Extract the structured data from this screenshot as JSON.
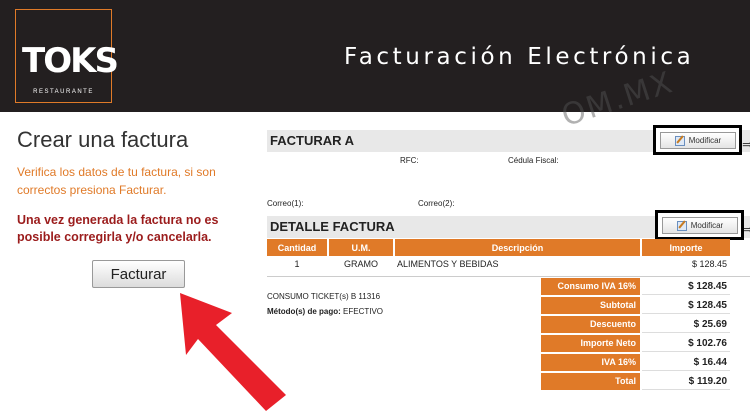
{
  "header": {
    "logo_text": "TOKS",
    "logo_subtitle": "RESTAURANTE",
    "title": "Facturación Electrónica",
    "watermark": "OM.MX"
  },
  "left": {
    "title": "Crear una factura",
    "note": "Verifica los datos de tu factura, si son correctos presiona Facturar.",
    "warning": "Una vez generada la factura no es posible corregirla y/o cancelarla.",
    "button_label": "Facturar"
  },
  "facturar_a": {
    "section_title": "FACTURAR A",
    "modify_label": "Modificar",
    "rfc_label": "RFC:",
    "cedula_label": "Cédula Fiscal:",
    "correo1_label": "Correo(1):",
    "correo2_label": "Correo(2):"
  },
  "detalle": {
    "section_title": "DETALLE FACTURA",
    "modify_label": "Modificar",
    "columns": [
      "Cantidad",
      "U.M.",
      "Descripción",
      "Importe"
    ],
    "rows": [
      [
        "1",
        "GRAMO",
        "ALIMENTOS Y BEBIDAS",
        "$ 128.45"
      ]
    ]
  },
  "info": {
    "consumo_ticket": "CONSUMO TICKET(s) B 11316",
    "metodo_label": "Método(s) de pago:",
    "metodo_value": "EFECTIVO"
  },
  "totals": [
    {
      "label": "Consumo IVA 16%",
      "value": "$ 128.45"
    },
    {
      "label": "Subtotal",
      "value": "$ 128.45"
    },
    {
      "label": "Descuento",
      "value": "$ 25.69"
    },
    {
      "label": "Importe Neto",
      "value": "$ 102.76"
    },
    {
      "label": "IVA 16%",
      "value": "$ 16.44"
    },
    {
      "label": "Total",
      "value": "$ 119.20"
    }
  ],
  "colors": {
    "accent": "#e07a28",
    "header_bg": "#231f20",
    "warning": "#9b1c1c",
    "arrow": "#e8202a"
  },
  "icons": [
    "edit-icon",
    "red-arrow-icon"
  ]
}
